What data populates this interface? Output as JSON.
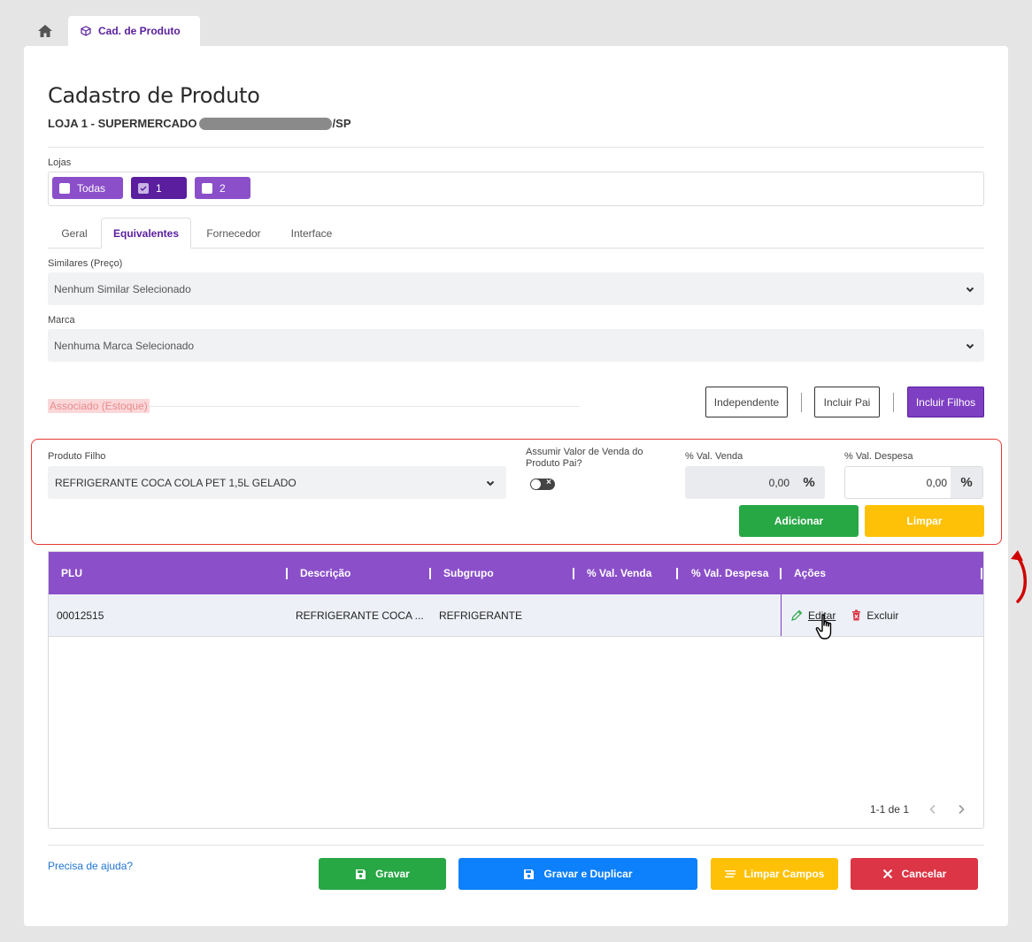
{
  "top_tabs": {
    "active_tab_label": "Cad. de Produto"
  },
  "page": {
    "title": "Cadastro de Produto",
    "store_prefix": "LOJA 1 - SUPERMERCADO",
    "store_suffix": "/SP"
  },
  "lojas": {
    "label": "Lojas",
    "chips": [
      {
        "label": "Todas",
        "checked": false
      },
      {
        "label": "1",
        "checked": true
      },
      {
        "label": "2",
        "checked": false
      }
    ]
  },
  "tabs": [
    "Geral",
    "Equivalentes",
    "Fornecedor",
    "Interface"
  ],
  "similares": {
    "label": "Similares (Preço)",
    "value": "Nenhum Similar Selecionado"
  },
  "marca": {
    "label": "Marca",
    "value": "Nenhuma Marca Selecionado"
  },
  "associado": {
    "label": "Associado (Estoque)",
    "options": [
      "Independente",
      "Incluir Pai",
      "Incluir Filhos"
    ],
    "selected": "Incluir Filhos"
  },
  "form": {
    "produto_filho_label": "Produto Filho",
    "produto_filho_value": "REFRIGERANTE COCA COLA PET 1,5L GELADO",
    "assumir_label": "Assumir Valor de Venda do Produto Pai?",
    "assumir_value": false,
    "val_venda_label": "% Val. Venda",
    "val_venda_value": "0,00",
    "val_despesa_label": "% Val. Despesa",
    "val_despesa_value": "0,00",
    "percent_symbol": "%",
    "adicionar_label": "Adicionar",
    "limpar_label": "Limpar"
  },
  "table": {
    "headers": [
      "PLU",
      "Descrição",
      "Subgrupo",
      "% Val. Venda",
      "% Val. Despesa",
      "Ações"
    ],
    "rows": [
      {
        "plu": "00012515",
        "descricao": "REFRIGERANTE COCA ...",
        "subgrupo": "REFRIGERANTE",
        "val_venda": "",
        "val_despesa": "",
        "edit_label": "Editar",
        "delete_label": "Excluir"
      }
    ],
    "pagination": "1-1 de 1"
  },
  "footer": {
    "help_link": "Precisa de ajuda?",
    "gravar": "Gravar",
    "gravar_duplicar": "Gravar e Duplicar",
    "limpar_campos": "Limpar Campos",
    "cancelar": "Cancelar"
  },
  "colors": {
    "brand_purple": "#5a1e9f",
    "header_purple": "#8b4fc9",
    "success": "#28a745",
    "primary": "#0d80fb",
    "warning": "#ffc107",
    "danger": "#dc3545",
    "highlight": "#e53935"
  }
}
